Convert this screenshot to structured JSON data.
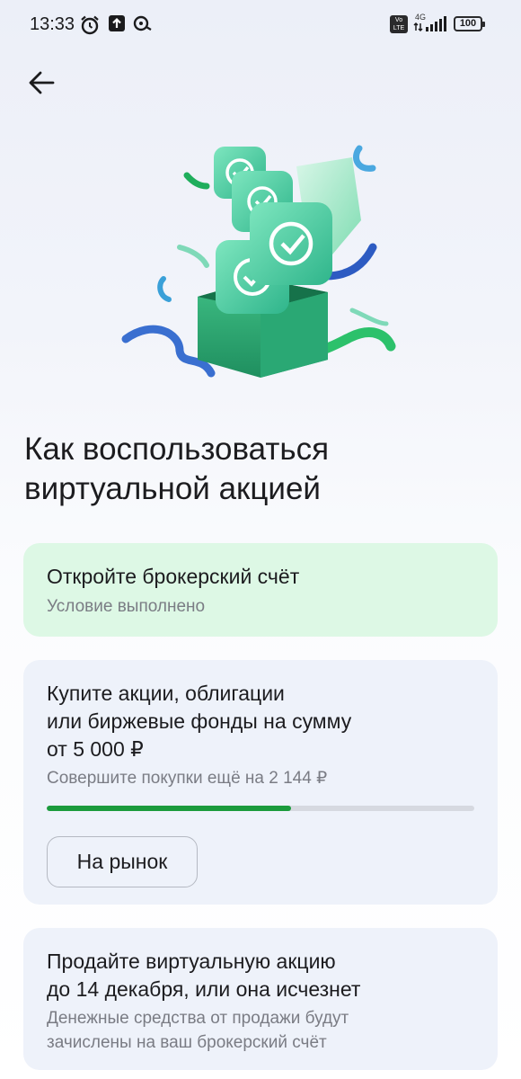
{
  "status_bar": {
    "time": "13:33",
    "volte": "Vo LTE",
    "network": "4G",
    "battery": "100",
    "icons": [
      "alarm-icon",
      "upload-icon",
      "vpn-icon",
      "signal-icon",
      "battery-icon"
    ]
  },
  "header": {
    "back_icon": "arrow-left-icon"
  },
  "hero": {
    "illustration": "gift-box-with-sber-logo-cubes"
  },
  "title": "Как воспользоваться виртуальной акцией",
  "steps": [
    {
      "title": "Откройте брокерский счёт",
      "subtitle": "Условие выполнено",
      "status": "done"
    },
    {
      "title_lines": [
        "Купите акции, облигации",
        "или биржевые фонды на сумму",
        "от 5 000 ₽"
      ],
      "subtitle": "Совершите покупки ещё на 2 144 ₽",
      "progress": 0.571,
      "button_label": "На рынок"
    },
    {
      "title_lines": [
        "Продайте виртуальную акцию",
        "до 14 декабря, или она исчезнет"
      ],
      "subtitle_lines": [
        "Денежные средства от продажи будут",
        "зачислены на ваш брокерский счёт"
      ]
    }
  ],
  "colors": {
    "done_card_bg": "#ddf8e5",
    "card_bg": "#eef2fa",
    "progress_fill": "#1b9b3c",
    "progress_track": "#d6d9e0",
    "text_primary": "#1c1c1f",
    "text_secondary": "#7a7c84"
  }
}
